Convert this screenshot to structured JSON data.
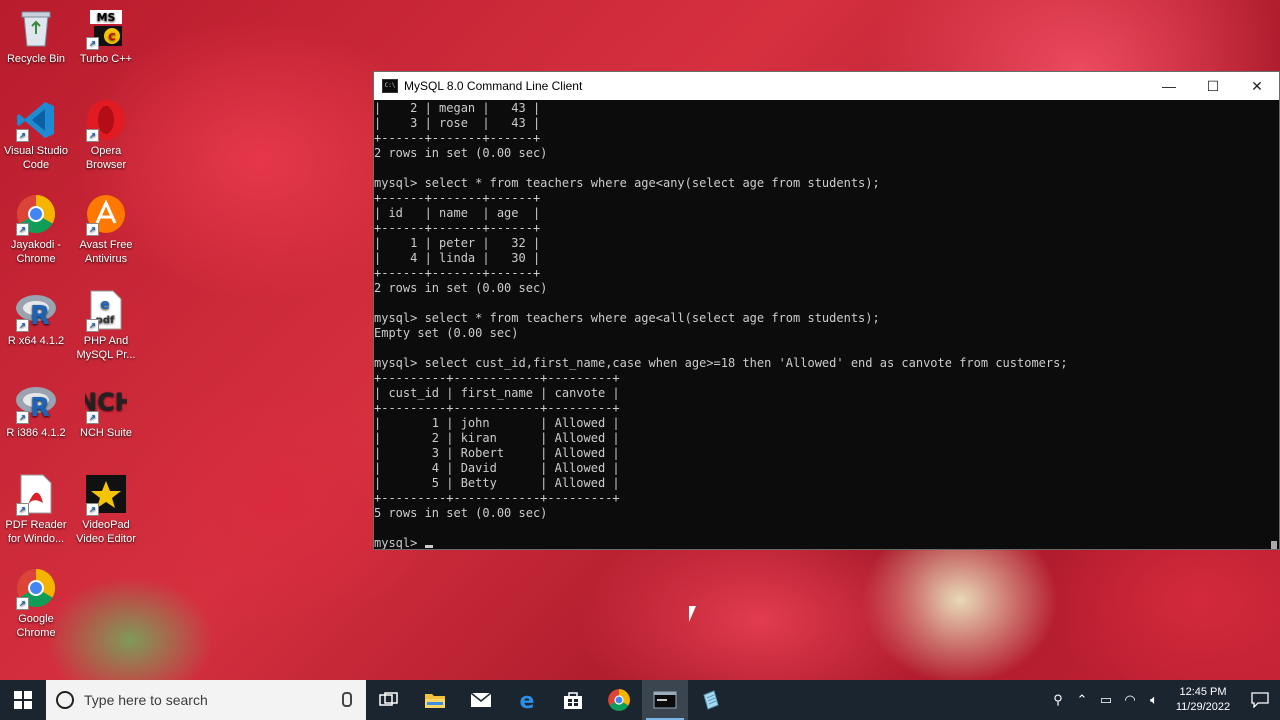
{
  "desktop": {
    "icons": [
      {
        "label": "Recycle Bin",
        "icon": "recycle-bin-icon"
      },
      {
        "label": "Turbo C++",
        "icon": "turbo-cpp-icon"
      },
      {
        "label": "Visual Studio Code",
        "icon": "vscode-icon"
      },
      {
        "label": "Opera Browser",
        "icon": "opera-icon"
      },
      {
        "label": "Jayakodi - Chrome",
        "icon": "chrome-icon"
      },
      {
        "label": "Avast Free Antivirus",
        "icon": "avast-icon"
      },
      {
        "label": "R x64 4.1.2",
        "icon": "r-icon"
      },
      {
        "label": "PHP And MySQL Pr...",
        "icon": "pdf-icon"
      },
      {
        "label": "R i386 4.1.2",
        "icon": "r-icon"
      },
      {
        "label": "NCH Suite",
        "icon": "nch-icon"
      },
      {
        "label": "PDF Reader for Windo...",
        "icon": "pdf-reader-icon"
      },
      {
        "label": "VideoPad Video Editor",
        "icon": "videopad-icon"
      },
      {
        "label": "Google Chrome",
        "icon": "chrome-icon"
      }
    ]
  },
  "window": {
    "title": "MySQL 8.0 Command Line Client",
    "controls": {
      "minimize": "—",
      "maximize": "☐",
      "close": "✕"
    },
    "console_lines": [
      "|    2 | megan |   43 |",
      "|    3 | rose  |   43 |",
      "+------+-------+------+",
      "2 rows in set (0.00 sec)",
      "",
      "mysql> select * from teachers where age<any(select age from students);",
      "+------+-------+------+",
      "| id   | name  | age  |",
      "+------+-------+------+",
      "|    1 | peter |   32 |",
      "|    4 | linda |   30 |",
      "+------+-------+------+",
      "2 rows in set (0.00 sec)",
      "",
      "mysql> select * from teachers where age<all(select age from students);",
      "Empty set (0.00 sec)",
      "",
      "mysql> select cust_id,first_name,case when age>=18 then 'Allowed' end as canvote from customers;",
      "+---------+------------+---------+",
      "| cust_id | first_name | canvote |",
      "+---------+------------+---------+",
      "|       1 | john       | Allowed |",
      "|       2 | kiran      | Allowed |",
      "|       3 | Robert     | Allowed |",
      "|       4 | David      | Allowed |",
      "|       5 | Betty      | Allowed |",
      "+---------+------------+---------+",
      "5 rows in set (0.00 sec)",
      ""
    ],
    "prompt": "mysql> "
  },
  "taskbar": {
    "search_placeholder": "Type here to search",
    "apps": [
      "task-view-icon",
      "file-explorer-icon",
      "mail-icon",
      "edge-icon",
      "store-icon",
      "chrome-icon",
      "mysql-console-icon",
      "notepad-icon"
    ],
    "time": "12:45 PM",
    "date": "11/29/2022"
  },
  "colors": {
    "console_bg": "#0c0c0c",
    "console_text": "#cccccc",
    "taskbar_bg": "#1b2530"
  }
}
